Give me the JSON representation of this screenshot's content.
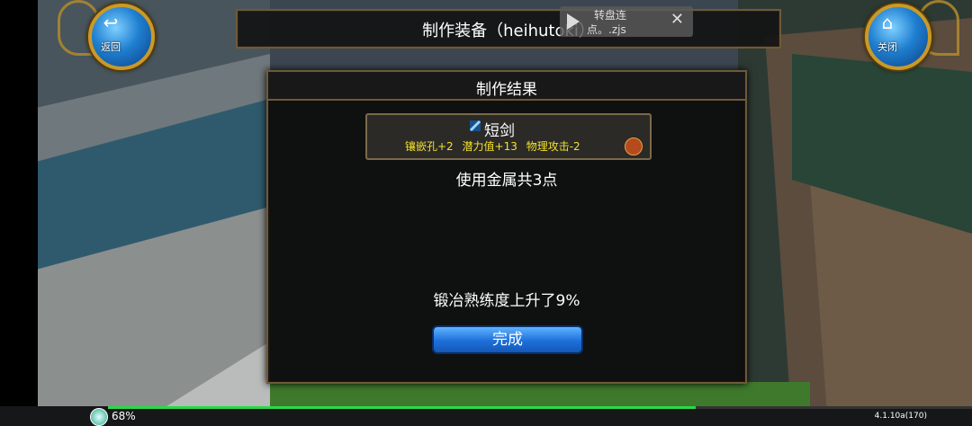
{
  "top_left_button": {
    "label": "返回",
    "icon": "back-arrow-icon"
  },
  "top_right_button": {
    "label": "关闭",
    "icon": "home-icon"
  },
  "title_bar": {
    "title": "制作装备（heihutoki）"
  },
  "overlay_popup": {
    "line1": "转盘连",
    "line2": "点。.zjs",
    "close": "✕"
  },
  "dialog": {
    "title": "制作结果",
    "item": {
      "name": "短剑",
      "stats": [
        "镶嵌孔+2",
        "潜力值+13",
        "物理攻击-2"
      ]
    },
    "message1": "使用金属共3点",
    "message2": "锻冶熟练度上升了9%",
    "button": "完成"
  },
  "bottom_bar": {
    "percent": "68%",
    "progress": 0.68,
    "version": "4.1.10a(170)"
  },
  "colors": {
    "gold": "#c99a2a",
    "stat_yellow": "#f2e12b",
    "button_blue": "#1e6fd9",
    "progress_green": "#2bd84a"
  }
}
